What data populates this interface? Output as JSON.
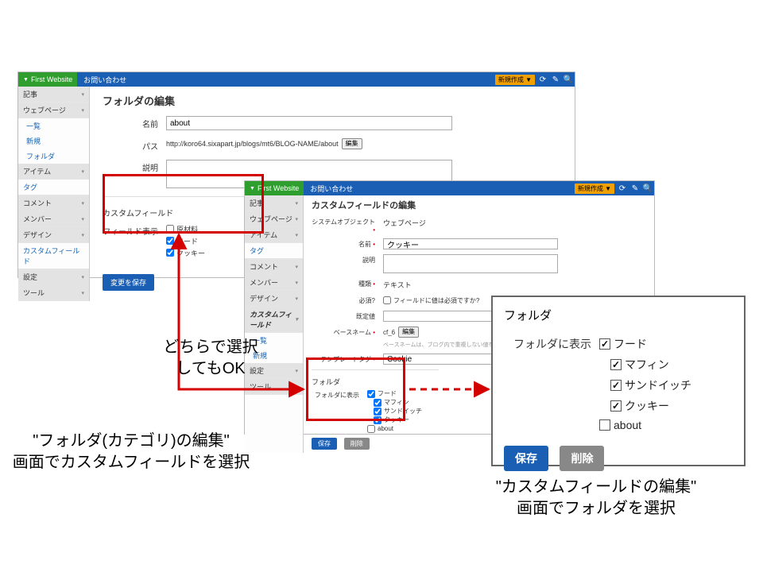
{
  "topbar": {
    "site_btn": "First Website",
    "blog_name": "お問い合わせ",
    "new_btn": "新規作成 ▼"
  },
  "side1": {
    "items": [
      "記事",
      "ウェブページ",
      "一覧",
      "新規",
      "フォルダ",
      "アイテム",
      "タグ",
      "コメント",
      "メンバー",
      "デザイン",
      "カスタムフィールド",
      "設定",
      "ツール"
    ]
  },
  "folder_edit": {
    "title": "フォルダの編集",
    "name_label": "名前",
    "name_value": "about",
    "path_label": "パス",
    "path_value": "http://koro64.sixapart.jp/blogs/mt6/BLOG-NAME/about",
    "edit_btn": "編集",
    "desc_label": "説明",
    "cf_heading": "カスタムフィールド",
    "fdisp_label": "フィールド表示",
    "cb": [
      {
        "label": "原材料",
        "checked": false
      },
      {
        "label": "フード",
        "checked": true
      },
      {
        "label": "クッキー",
        "checked": true
      }
    ],
    "save": "変更を保存"
  },
  "side2": {
    "items": [
      "記事",
      "ウェブページ",
      "アイテム",
      "タグ",
      "コメント",
      "メンバー",
      "デザイン",
      "カスタムフィールド",
      "一覧",
      "新規",
      "設定",
      "ツール"
    ]
  },
  "cf_edit": {
    "title": "カスタムフィールドの編集",
    "sysobj_label": "システムオブジェクト",
    "sysobj_value": "ウェブページ",
    "name_label": "名前",
    "name_value": "クッキー",
    "desc_label": "説明",
    "type_label": "種類",
    "type_value": "テキスト",
    "req_label": "必須?",
    "req_cb": "フィールドに値は必須ですか?",
    "default_label": "既定値",
    "basename_label": "ベースネーム",
    "basename_value": "cf_6",
    "basename_hint": "ベースネームは、ブログ内で重複しない値を入力してください。",
    "tag_label": "テンプレートタグ",
    "tag_value": "Cookie",
    "folder_heading": "フォルダ",
    "folder_disp_label": "フォルダに表示",
    "folder_cb": [
      {
        "label": "フード",
        "checked": true
      },
      {
        "label": "マフィン",
        "checked": true
      },
      {
        "label": "サンドイッチ",
        "checked": true
      },
      {
        "label": "クッキー",
        "checked": true
      },
      {
        "label": "about",
        "checked": false
      }
    ],
    "save": "保存",
    "delete": "削除",
    "edit_btn": "編集"
  },
  "magnify": {
    "heading": "フォルダ",
    "disp_label": "フォルダに表示",
    "items": [
      {
        "label": "フード",
        "checked": true,
        "indent": 0
      },
      {
        "label": "マフィン",
        "checked": true,
        "indent": 1
      },
      {
        "label": "サンドイッチ",
        "checked": true,
        "indent": 1
      },
      {
        "label": "クッキー",
        "checked": true,
        "indent": 1
      },
      {
        "label": "about",
        "checked": false,
        "indent": 0
      }
    ],
    "save": "保存",
    "delete": "削除"
  },
  "annotations": {
    "middle": "どちらで選択\nしてもOK",
    "left_caption": "\"フォルダ(カテゴリ)の編集\"\n画面でカスタムフィールドを選択",
    "right_caption": "\"カスタムフィールドの編集\"\n画面でフォルダを選択"
  }
}
